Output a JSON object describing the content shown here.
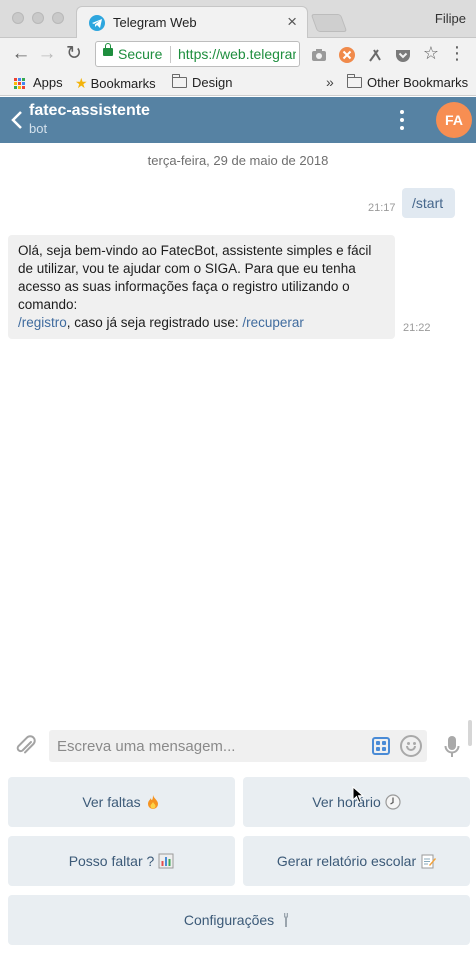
{
  "browser": {
    "tab_title": "Telegram Web",
    "tab_close": "×",
    "profile_name": "Filipe",
    "secure_label": "Secure",
    "url": "https://web.telegram.org",
    "bookmarks": {
      "apps": "Apps",
      "bookmarks": "Bookmarks",
      "design": "Design",
      "overflow": "»",
      "other": "Other Bookmarks"
    }
  },
  "chat": {
    "title": "fatec-assistente",
    "subtitle": "bot",
    "avatar_initials": "FA",
    "avatar_color": "#f78e52",
    "header_color": "#5682a3"
  },
  "messages": {
    "date": "terça-feira, 29 de maio de 2018",
    "outgoing": {
      "text": "/start",
      "time": "21:17"
    },
    "incoming": {
      "text": "Olá, seja bem-vindo ao FatecBot, assistente simples e fácil de utilizar, vou te ajudar com o SIGA. Para que eu tenha acesso as suas informações faça o registro utilizando o comando:",
      "link_register": "/registro",
      "middle": ", caso já seja registrado use: ",
      "link_recover": "/recuperar",
      "time": "21:22"
    }
  },
  "composer": {
    "placeholder": "Escreva uma mensagem..."
  },
  "keyboard": {
    "ver_faltas": "Ver faltas",
    "ver_horario": "Ver horário",
    "posso_faltar": "Posso faltar ?",
    "gerar_relatorio": "Gerar relatório escolar",
    "configuracoes": "Configurações"
  }
}
